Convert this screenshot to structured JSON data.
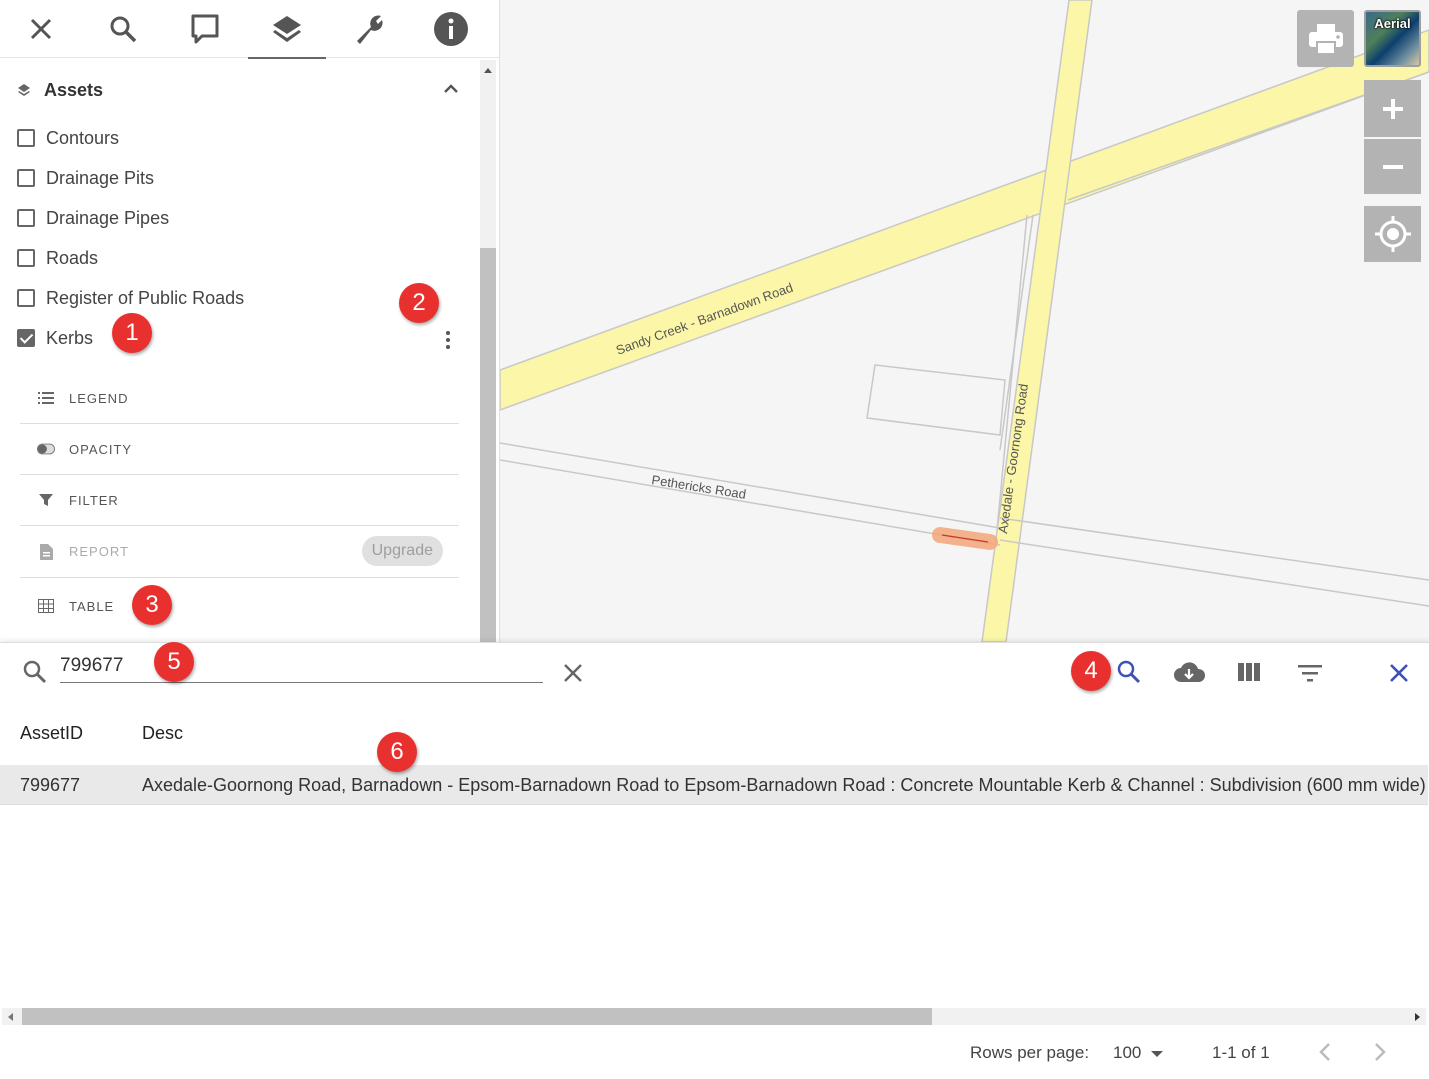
{
  "toolbar": {
    "items": [
      {
        "name": "close",
        "icon": "close-icon"
      },
      {
        "name": "search",
        "icon": "search-icon"
      },
      {
        "name": "comment",
        "icon": "comment-icon"
      },
      {
        "name": "layers",
        "icon": "layers-icon",
        "active": true
      },
      {
        "name": "tools",
        "icon": "wrench-icon"
      },
      {
        "name": "info",
        "icon": "info-icon"
      }
    ]
  },
  "layers_panel": {
    "group_title": "Assets",
    "layers": [
      {
        "label": "Contours",
        "checked": false
      },
      {
        "label": "Drainage Pits",
        "checked": false
      },
      {
        "label": "Drainage Pipes",
        "checked": false
      },
      {
        "label": "Roads",
        "checked": false
      },
      {
        "label": "Register of Public Roads",
        "checked": false
      },
      {
        "label": "Kerbs",
        "checked": true
      }
    ],
    "options": {
      "legend": "LEGEND",
      "opacity": "OPACITY",
      "filter": "FILTER",
      "report": "REPORT",
      "report_chip": "Upgrade",
      "table": "TABLE"
    }
  },
  "map": {
    "labels": {
      "road1": "Sandy Creek - Barnadown Road",
      "road2": "Axedale - Goornong Road",
      "road3": "Pethericks Road"
    },
    "aerial_label": "Aerial",
    "colors": {
      "road_fill": "#fbf6a8",
      "highlight": "#f4a77a"
    }
  },
  "badges": {
    "b1": "1",
    "b2": "2",
    "b3": "3",
    "b4": "4",
    "b5": "5",
    "b6": "6"
  },
  "table": {
    "search_value": "799677",
    "columns": {
      "asset_id": "AssetID",
      "desc": "Desc"
    },
    "rows": [
      {
        "asset_id": "799677",
        "desc": "Axedale-Goornong Road, Barnadown - Epsom-Barnadown Road to Epsom-Barnadown Road : Concrete Mountable Kerb & Channel : Subdivision (600 mm wide)"
      }
    ],
    "pagination": {
      "rows_per_page_label": "Rows per page:",
      "rows_per_page": "100",
      "range": "1-1 of 1"
    },
    "accent_color": "#3f51b5"
  }
}
